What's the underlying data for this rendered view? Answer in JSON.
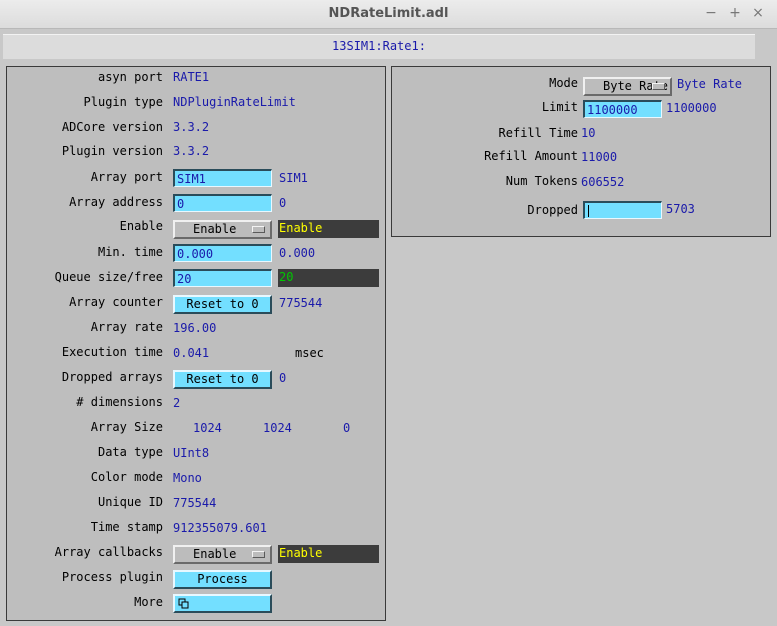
{
  "window": {
    "title": "NDRateLimit.adl",
    "minimize_icon": "minimize-icon",
    "maximize_icon": "maximize-icon",
    "close_icon": "close-icon"
  },
  "prefix": "13SIM1:Rate1:",
  "left": {
    "asyn_port": {
      "label": "asyn port",
      "value": "RATE1"
    },
    "plugin_type": {
      "label": "Plugin type",
      "value": "NDPluginRateLimit"
    },
    "adcore_version": {
      "label": "ADCore version",
      "value": "3.3.2"
    },
    "plugin_version": {
      "label": "Plugin version",
      "value": "3.3.2"
    },
    "array_port": {
      "label": "Array port",
      "input": "SIM1",
      "readback": "SIM1"
    },
    "array_address": {
      "label": "Array address",
      "input": "0",
      "readback": "0"
    },
    "enable": {
      "label": "Enable",
      "menu": "Enable",
      "readback": "Enable"
    },
    "min_time": {
      "label": "Min. time",
      "input": "0.000",
      "readback": "0.000"
    },
    "queue": {
      "label": "Queue size/free",
      "input": "20",
      "readback": "20"
    },
    "array_counter": {
      "label": "Array counter",
      "button": "Reset to 0",
      "value": "775544"
    },
    "array_rate": {
      "label": "Array rate",
      "value": "196.00"
    },
    "execution_time": {
      "label": "Execution time",
      "value": "0.041",
      "unit": "msec"
    },
    "dropped_arrays": {
      "label": "Dropped arrays",
      "button": "Reset to 0",
      "value": "0"
    },
    "dimensions": {
      "label": "# dimensions",
      "value": "2"
    },
    "array_size": {
      "label": "Array Size",
      "values": [
        "1024",
        "1024",
        "0"
      ]
    },
    "data_type": {
      "label": "Data type",
      "value": "UInt8"
    },
    "color_mode": {
      "label": "Color mode",
      "value": "Mono"
    },
    "unique_id": {
      "label": "Unique ID",
      "value": "775544"
    },
    "time_stamp": {
      "label": "Time stamp",
      "value": "912355079.601"
    },
    "array_callbacks": {
      "label": "Array callbacks",
      "menu": "Enable",
      "readback": "Enable"
    },
    "process_plugin": {
      "label": "Process plugin",
      "button": "Process"
    },
    "more": {
      "label": "More",
      "icon": "related-display-icon"
    }
  },
  "right": {
    "mode": {
      "label": "Mode",
      "menu": "Byte Rate",
      "readback": "Byte Rate"
    },
    "limit": {
      "label": "Limit",
      "input": "1100000",
      "readback": "1100000"
    },
    "refill_time": {
      "label": "Refill Time",
      "value": "10"
    },
    "refill_amount": {
      "label": "Refill Amount",
      "value": "11000"
    },
    "num_tokens": {
      "label": "Num Tokens",
      "value": "606552"
    },
    "dropped": {
      "label": "Dropped",
      "input": "",
      "readback": "5703"
    }
  },
  "colors": {
    "background": "#c8c8c8",
    "panel": "#bebebe",
    "input_bg": "#73dfff",
    "readback_text": "#1a1aaa",
    "dark_readback_bg": "#3c3c3c",
    "dark_readback_text": "#ffff00"
  }
}
